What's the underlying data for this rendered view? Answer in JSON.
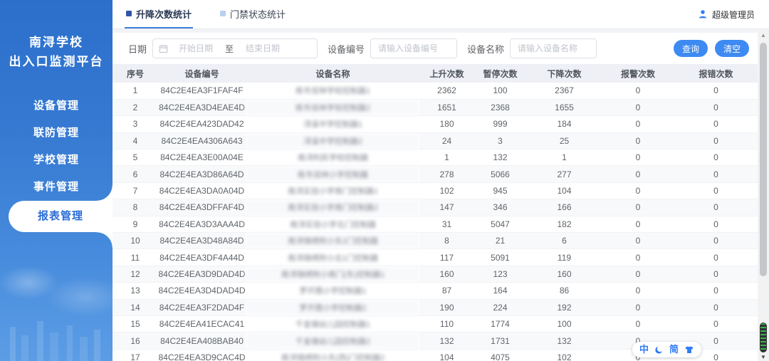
{
  "app": {
    "title_line1": "南浔学校",
    "title_line2": "出入口监测平台"
  },
  "sidebar": {
    "items": [
      {
        "key": "device",
        "label": "设备管理",
        "active": false
      },
      {
        "key": "joint-defense",
        "label": "联防管理",
        "active": false
      },
      {
        "key": "school",
        "label": "学校管理",
        "active": false
      },
      {
        "key": "event",
        "label": "事件管理",
        "active": false
      },
      {
        "key": "report",
        "label": "报表管理",
        "active": true
      }
    ]
  },
  "header": {
    "tabs": [
      {
        "key": "lift-count-stats",
        "label": "升降次数统计",
        "active": true
      },
      {
        "key": "door-status-stats",
        "label": "门禁状态统计",
        "active": false
      }
    ],
    "user": {
      "name": "超级管理员"
    }
  },
  "filters": {
    "date_label": "日期",
    "date_start_placeholder": "开始日期",
    "date_separator": "至",
    "date_end_placeholder": "结束日期",
    "device_id_label": "设备编号",
    "device_id_placeholder": "请输入设备编号",
    "device_name_label": "设备名称",
    "device_name_placeholder": "请输入设备名称",
    "search_button": "查询",
    "clear_button": "清空"
  },
  "table": {
    "columns": [
      "序号",
      "设备编号",
      "设备名称",
      "上升次数",
      "暂停次数",
      "下降次数",
      "报警次数",
      "报错次数"
    ],
    "device_name_blurred": true,
    "rows": [
      [
        1,
        "84C2E4EA3F1FAF4F",
        "练市双林学校控制器1",
        2362,
        100,
        2367,
        0,
        0
      ],
      [
        2,
        "84C2E4EA3D4EAE4D",
        "练市双林学校控制器2",
        1651,
        2368,
        1655,
        0,
        0
      ],
      [
        3,
        "84C2E4EA423DAD42",
        "浔溪中学控制器1",
        180,
        999,
        184,
        0,
        0
      ],
      [
        4,
        "84C2E4EA4306A643",
        "浔溪中学控制器2",
        24,
        3,
        25,
        0,
        0
      ],
      [
        5,
        "84C2E4EA3E00A04E",
        "南浔利民学校控制器",
        1,
        132,
        1,
        0,
        0
      ],
      [
        6,
        "84C2E4EA3D86A64D",
        "练市双林小学控制器",
        278,
        5066,
        277,
        0,
        0
      ],
      [
        7,
        "84C2E4EA3DA0A04D",
        "南浔实验小学南门控制器1",
        102,
        945,
        104,
        0,
        0
      ],
      [
        8,
        "84C2E4EA3DFFAF4D",
        "南浔实验小学南门控制器2",
        147,
        346,
        166,
        0,
        0
      ],
      [
        9,
        "84C2E4EA3D3AAA4D",
        "南浔实验小学北门控制器",
        31,
        5047,
        182,
        0,
        0
      ],
      [
        10,
        "84C2E4EA3D48A84D",
        "南浔锦绣附小东2门控制器",
        8,
        21,
        6,
        0,
        0
      ],
      [
        11,
        "84C2E4EA3DF4A44D",
        "南浔锦绣附小北1门控制器",
        117,
        5091,
        119,
        0,
        0
      ],
      [
        12,
        "84C2E4EA3D9DAD4D",
        "南浔锦绣附小南门(东)控制器1",
        160,
        123,
        160,
        0,
        0
      ],
      [
        13,
        "84C2E4EA3D4DAD4D",
        "罗开图小学控制器1",
        87,
        164,
        86,
        0,
        0
      ],
      [
        14,
        "84C2E4EA3F2DAD4F",
        "罗开图小学控制器2",
        190,
        224,
        192,
        0,
        0
      ],
      [
        15,
        "84C2E4EA41ECAC41",
        "千金镇幼儿园控制器1",
        110,
        1774,
        100,
        0,
        0
      ],
      [
        16,
        "84C2E4EA408BAB40",
        "千金镇幼儿园控制器2",
        132,
        1731,
        132,
        0,
        0
      ],
      [
        17,
        "84C2E4EA3D9CAC4D",
        "南浔锦绣附小东(西)门控制器2",
        104,
        4075,
        102,
        0,
        0
      ]
    ]
  },
  "widgets": {
    "translate_bar": {
      "chinese_label": "中",
      "simplified_label": "简"
    }
  },
  "colors": {
    "accent": "#3d8af2",
    "sidebar_top": "#2b6fcb",
    "sidebar_bottom": "#5c9de5",
    "tab_underline": "#3d7fd8"
  }
}
